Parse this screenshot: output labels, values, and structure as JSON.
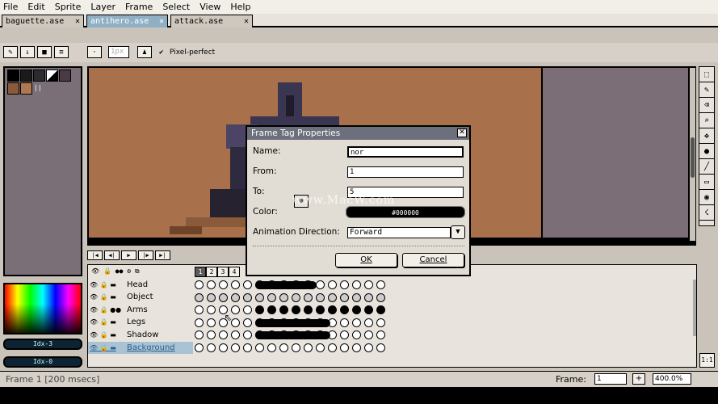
{
  "menu": [
    "File",
    "Edit",
    "Sprite",
    "Layer",
    "Frame",
    "Select",
    "View",
    "Help"
  ],
  "tabs": [
    {
      "label": "baguette.ase",
      "close": "✕"
    },
    {
      "label": "antihero.ase",
      "close": "✕"
    },
    {
      "label": "attack.ase",
      "close": "✕"
    }
  ],
  "toolbar": {
    "brush_size": "1px",
    "pixel_perfect_label": "Pixel-perfect"
  },
  "palette": {
    "colors": [
      "#000000",
      "#1a1a1a",
      "#2b2b2b",
      "#ffffff",
      "#4a3a44",
      "#8a5a3a",
      "#b07850"
    ],
    "fg_index": "Idx-3",
    "bg_index": "Idx-0"
  },
  "timeline": {
    "frame_numbers": [
      "1",
      "2",
      "3",
      "4"
    ],
    "layers": [
      {
        "name": "Head"
      },
      {
        "name": "Object"
      },
      {
        "name": "Arms"
      },
      {
        "name": "Legs"
      },
      {
        "name": "Shadow"
      },
      {
        "name": "Background"
      }
    ]
  },
  "dialog": {
    "title": "Frame Tag Properties",
    "close": "✕",
    "name_label": "Name:",
    "name_value": "nor",
    "from_label": "From:",
    "from_value": "1",
    "to_label": "To:",
    "to_value": "5",
    "color_label": "Color:",
    "color_value": "#000000",
    "direction_label": "Animation Direction:",
    "direction_value": "Forward",
    "ok_label": "OK",
    "cancel_label": "Cancel"
  },
  "status": {
    "frame_info": "Frame 1 [200 msecs]",
    "frame_label": "Frame:",
    "frame_value": "1",
    "add_label": "+",
    "zoom_value": "400.0%",
    "ratio_label": "1:1"
  },
  "watermark": "www.MacW.com"
}
